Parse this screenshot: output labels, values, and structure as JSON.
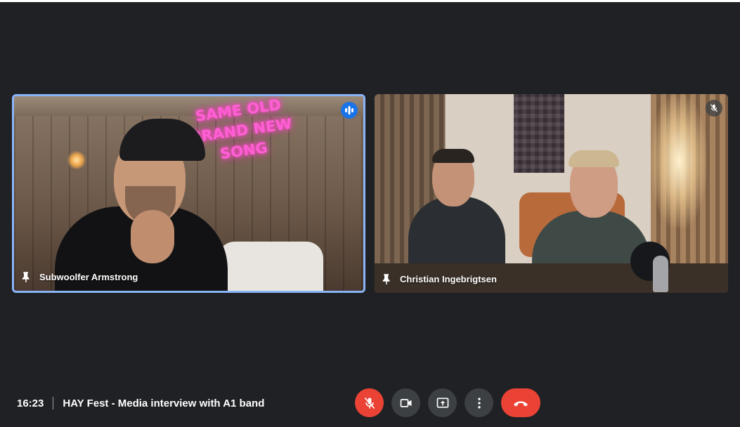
{
  "colors": {
    "background": "#202124",
    "active_speaker_border": "#8ab4f8",
    "button_gray": "#3c4043",
    "danger_red": "#ea4335",
    "speaking_blue": "#1a73e8",
    "neon_pink": "#ff5fd4"
  },
  "participants": [
    {
      "name": "Subwoolfer Armstrong",
      "active_speaker": true,
      "status_icon": "speaking-indicator-icon",
      "background_neon_sign": [
        "SAME OLD",
        "BRAND NEW",
        "SONG"
      ]
    },
    {
      "name": "Christian Ingebrigtsen",
      "active_speaker": false,
      "status_icon": "mic-off-icon"
    }
  ],
  "meeting": {
    "time": "16:23",
    "title": "HAY Fest - Media interview with A1 band"
  },
  "controls": {
    "microphone": {
      "icon": "mic-off-icon",
      "state": "muted"
    },
    "camera": {
      "icon": "videocam-icon",
      "state": "on"
    },
    "present": {
      "icon": "present-screen-icon"
    },
    "more": {
      "icon": "more-vert-icon"
    },
    "leave": {
      "icon": "call-end-icon"
    }
  }
}
